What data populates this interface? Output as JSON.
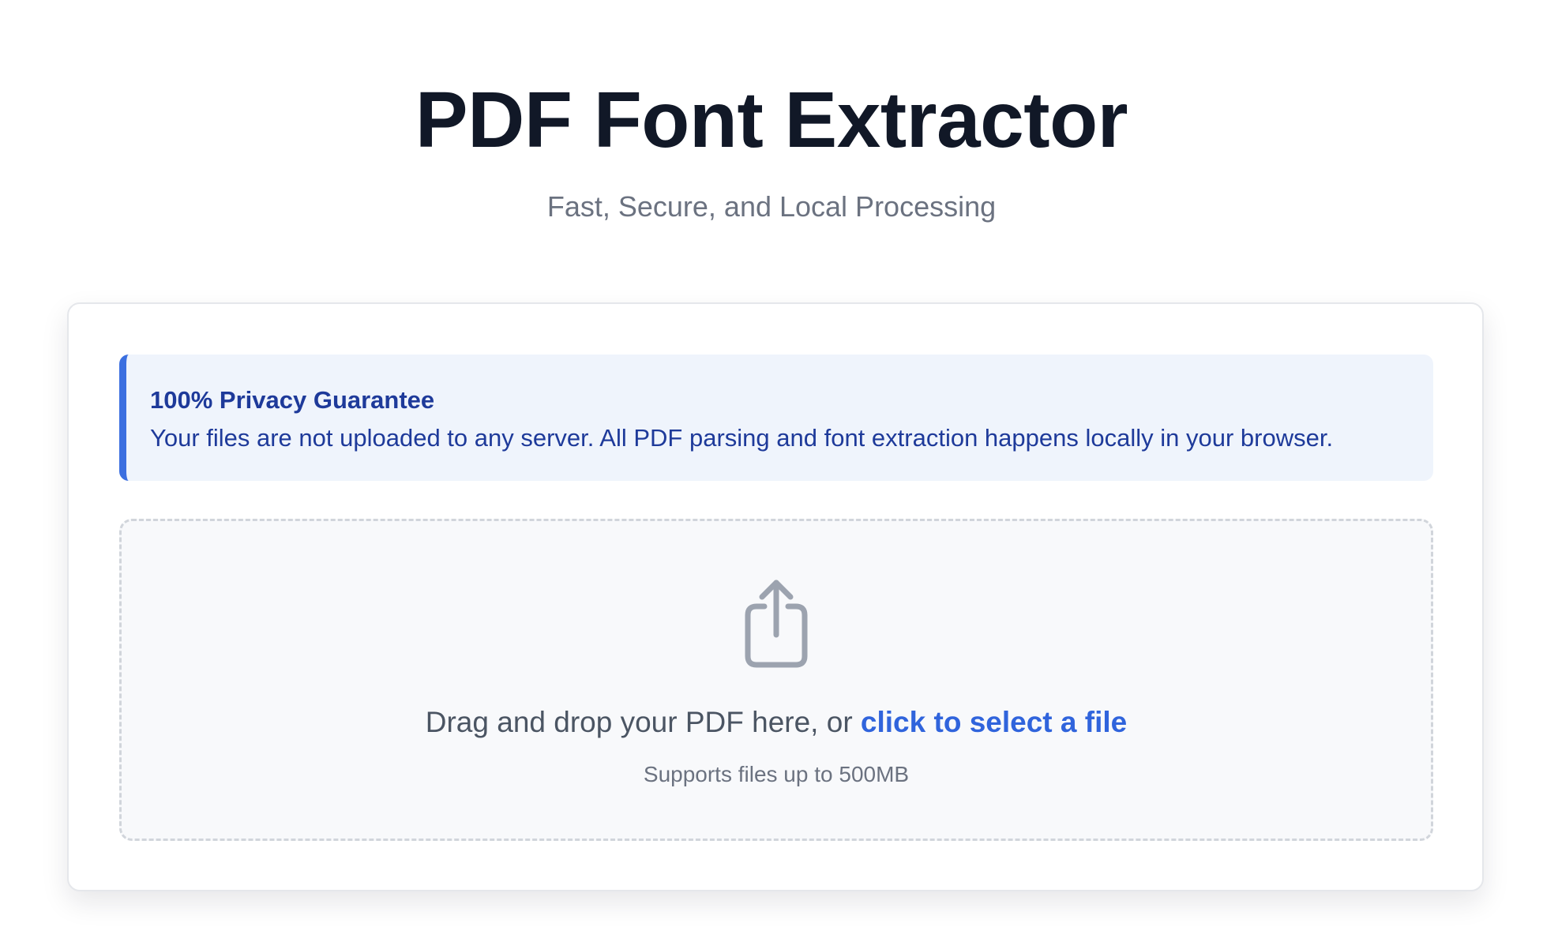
{
  "header": {
    "title": "PDF Font Extractor",
    "subtitle": "Fast, Secure, and Local Processing"
  },
  "privacy_notice": {
    "title": "100% Privacy Guarantee",
    "text": "Your files are not uploaded to any server. All PDF parsing and font extraction happens locally in your browser."
  },
  "dropzone": {
    "icon": "upload-icon",
    "prompt_text": "Drag and drop your PDF here, or ",
    "select_link": "click to select a file",
    "hint": "Supports files up to 500MB"
  },
  "colors": {
    "accent": "#3064dc",
    "notice_border": "#3b6fe0",
    "notice_bg": "#eff4fc",
    "notice_text": "#1e3a9a",
    "title": "#111827",
    "muted": "#6b7280"
  }
}
